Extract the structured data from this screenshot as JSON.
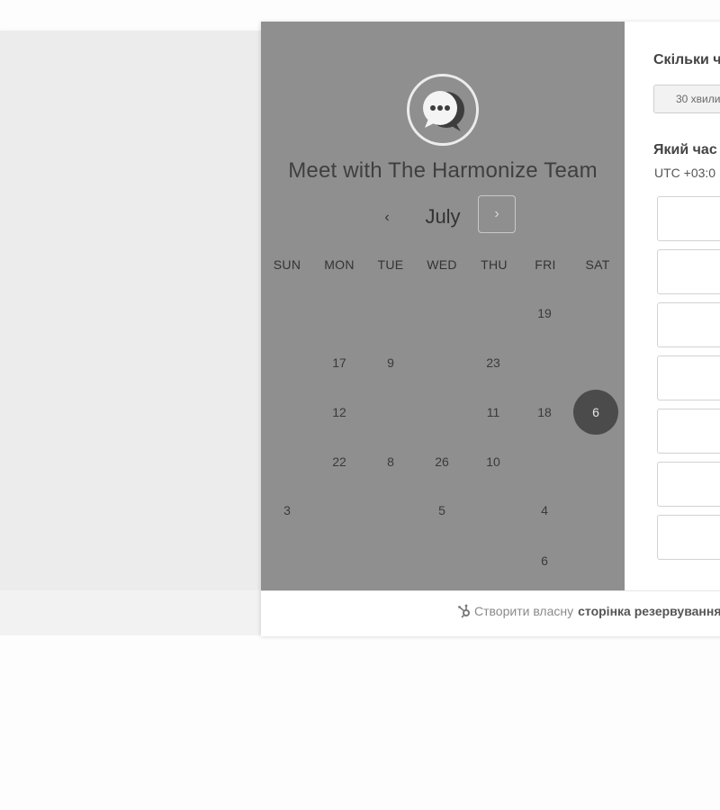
{
  "widget": {
    "title": "Meet with The Harmonize Team",
    "avatar_icon": "chat-bubble-icon"
  },
  "calendar": {
    "month": "July",
    "prev_icon": "‹",
    "next_icon": "›",
    "weekdays": [
      "SUN",
      "MON",
      "TUE",
      "WED",
      "THU",
      "FRI",
      "SAT"
    ],
    "days": [
      {
        "label": "19",
        "col": 5,
        "row": 0
      },
      {
        "label": "17",
        "col": 1,
        "row": 1
      },
      {
        "label": "9",
        "col": 2,
        "row": 1
      },
      {
        "label": "23",
        "col": 4,
        "row": 1
      },
      {
        "label": "12",
        "col": 1,
        "row": 2
      },
      {
        "label": "11",
        "col": 4,
        "row": 2
      },
      {
        "label": "18",
        "col": 5,
        "row": 2
      },
      {
        "label": "6",
        "col": 6,
        "row": 2,
        "selected": true
      },
      {
        "label": "22",
        "col": 1,
        "row": 3
      },
      {
        "label": "8",
        "col": 2,
        "row": 3
      },
      {
        "label": "26",
        "col": 3,
        "row": 3
      },
      {
        "label": "10",
        "col": 4,
        "row": 3
      },
      {
        "label": "3",
        "col": 0,
        "row": 4
      },
      {
        "label": "5",
        "col": 3,
        "row": 4
      },
      {
        "label": "4",
        "col": 5,
        "row": 4
      },
      {
        "label": "6",
        "col": 5,
        "row": 5
      }
    ]
  },
  "booking": {
    "duration_heading": "Скільки ч",
    "duration_option": "30 хвили",
    "time_heading": "Який час",
    "timezone": "UTC +03:0"
  },
  "footer": {
    "prefix": "Створити власну",
    "link": "сторінка резервування"
  },
  "colors": {
    "calendar_panel": "#8f8f8f",
    "selected_day": "#4b4b4b"
  }
}
